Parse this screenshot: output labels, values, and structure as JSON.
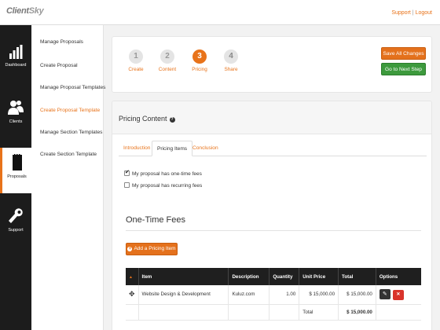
{
  "header": {
    "logo_text_client": "Client",
    "logo_text_sky": "Sky",
    "support_label": "Support",
    "separator": " | ",
    "logout_label": "Logout"
  },
  "leftnav": {
    "items": [
      {
        "label": "Dashboard",
        "icon": "bar-chart-icon"
      },
      {
        "label": "Clients",
        "icon": "users-icon"
      },
      {
        "label": "Proposals",
        "icon": "document-icon",
        "active": true
      },
      {
        "label": "Support",
        "icon": "wrench-icon"
      }
    ]
  },
  "submenu": {
    "items": [
      {
        "label": "Manage Proposals"
      },
      {
        "label": "Create Proposal"
      },
      {
        "label": "Manage Proposal Templates"
      },
      {
        "label": "Create Proposal Template",
        "active": true
      },
      {
        "label": "Manage Section Templates"
      },
      {
        "label": "Create Section Template"
      }
    ]
  },
  "steps": [
    {
      "number": "1",
      "label": "Create",
      "state": "done"
    },
    {
      "number": "2",
      "label": "Content",
      "state": "done"
    },
    {
      "number": "3",
      "label": "Pricing",
      "state": "active"
    },
    {
      "number": "4",
      "label": "Share",
      "state": "todo"
    }
  ],
  "actions": {
    "save_all": "Save All Changes",
    "next_step": "Go to Next Step"
  },
  "pricing": {
    "title": "Pricing Content",
    "help_glyph": "?",
    "tabs": [
      "Introduction",
      "Pricing Items",
      "Conclusion"
    ],
    "active_tab": "Pricing Items",
    "checkbox_one_time": "My proposal has one-time fees",
    "checkbox_one_time_checked": true,
    "checkbox_recurring": "My proposal has recurring fees",
    "checkbox_recurring_checked": false,
    "fees_title": "One-Time Fees",
    "add_item_label": "Add a Pricing Item",
    "table": {
      "columns": [
        "Item",
        "Description",
        "Quantity",
        "Unit Price",
        "Total",
        "Options"
      ],
      "rows": [
        {
          "item": "Website Design & Development",
          "description": "Kuluz.com",
          "quantity": "1.00",
          "unit_price": "$ 15,000.00",
          "total": "$ 15,000.00"
        }
      ],
      "total_label": "Total",
      "total_value": "$ 15,000.00"
    }
  },
  "colors": {
    "accent": "#e8731a",
    "green": "#3d9a3d",
    "dark_nav": "#1c1c1c",
    "delete": "#d9342b"
  }
}
